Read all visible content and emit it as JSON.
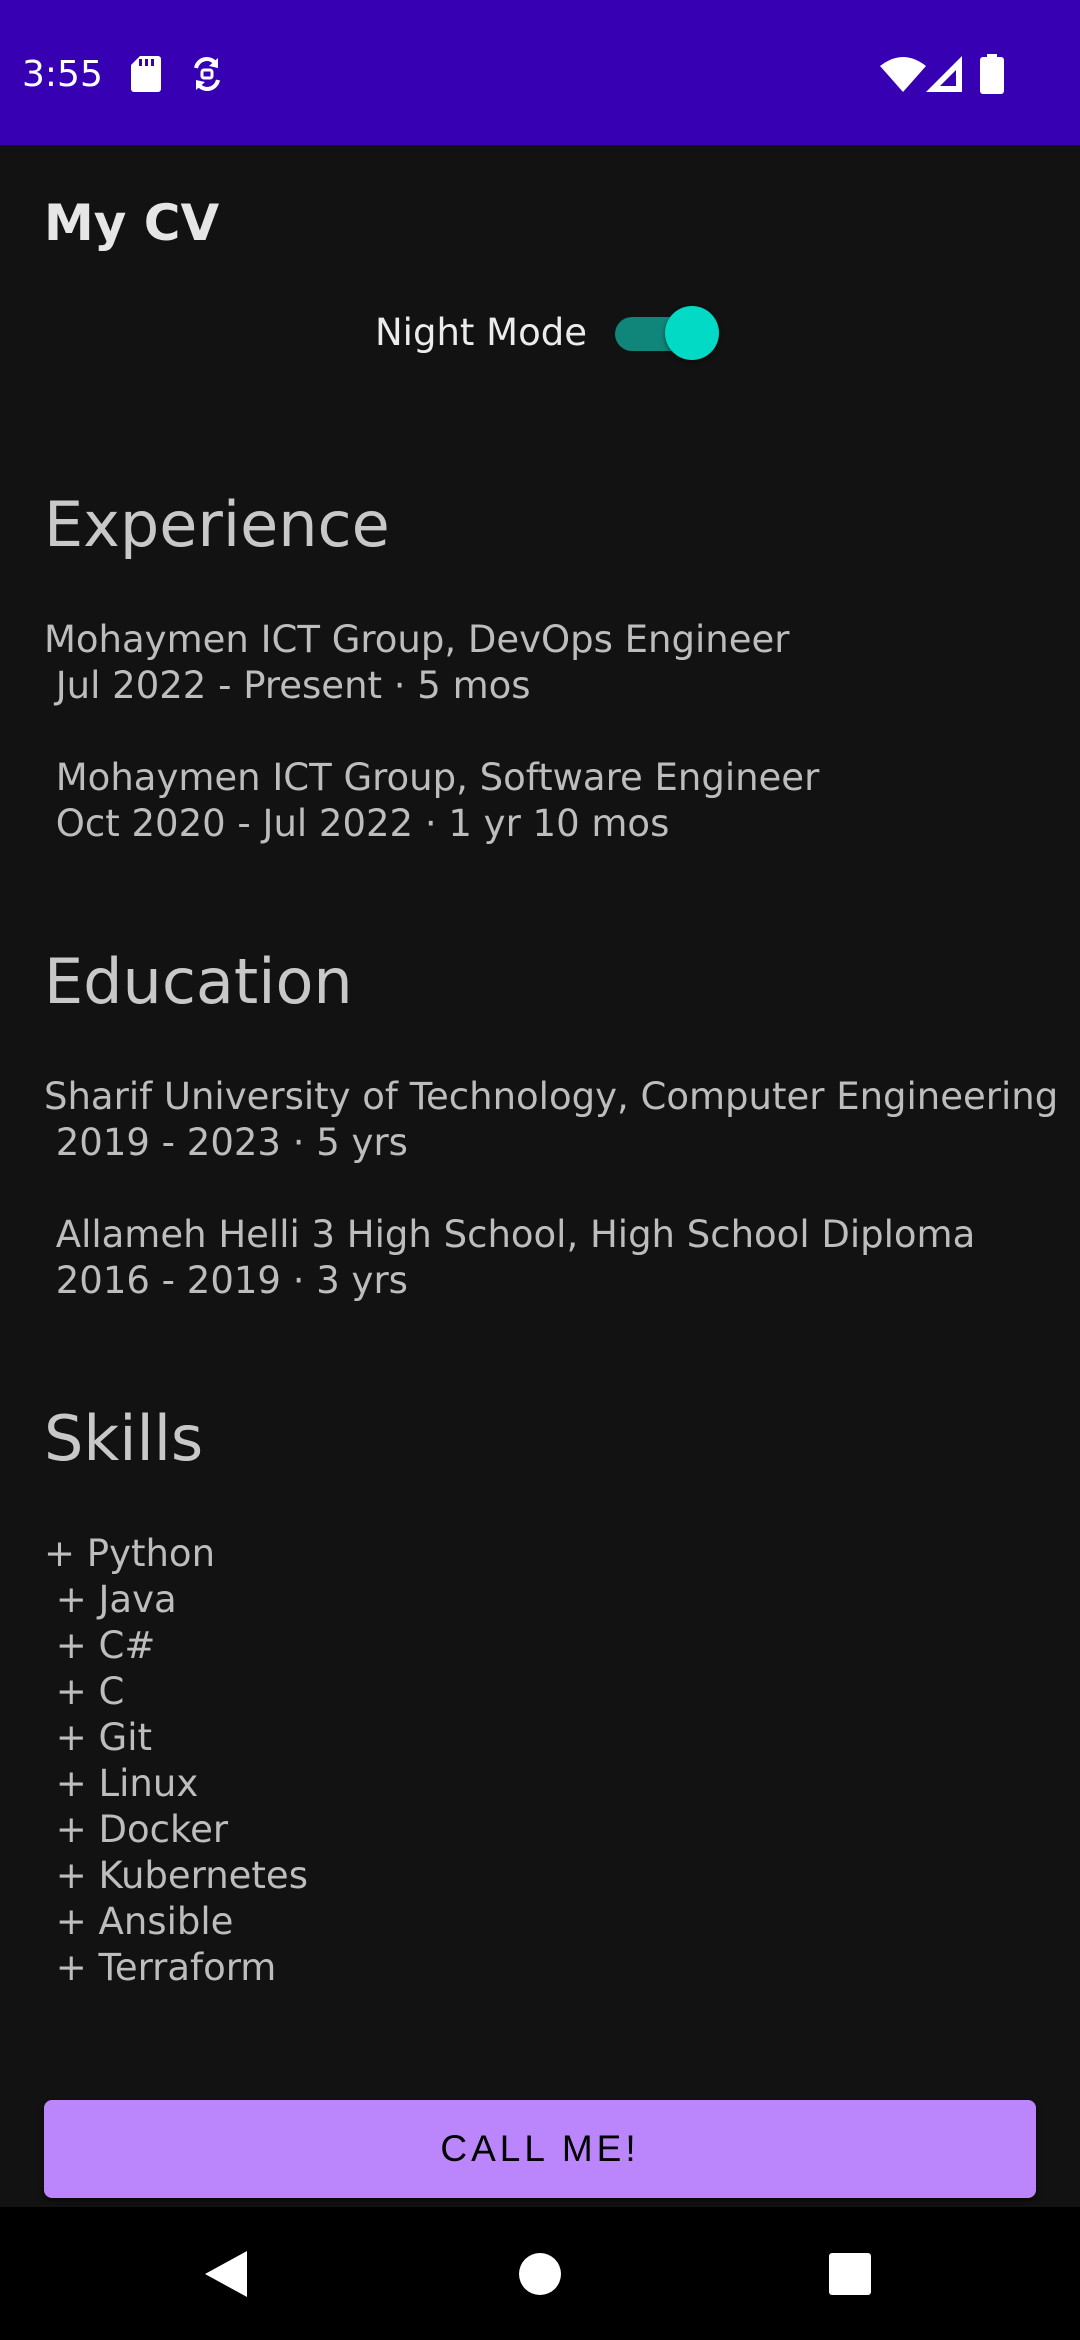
{
  "status_bar": {
    "time": "3:55",
    "icons_left": [
      "sd-card-icon",
      "sync-icon"
    ],
    "icons_right": [
      "wifi-icon",
      "signal-icon",
      "battery-icon"
    ],
    "background_color": "#3700b3"
  },
  "app": {
    "title": "My CV",
    "night_mode_label": "Night Mode",
    "night_mode_on": true,
    "accent_color": "#03dac5"
  },
  "experience": {
    "heading": "Experience",
    "body": "Mohaymen ICT Group, DevOps Engineer\n Jul 2022 - Present · 5 mos\n\n Mohaymen ICT Group, Software Engineer\n Oct 2020 - Jul 2022 · 1 yr 10 mos"
  },
  "education": {
    "heading": "Education",
    "body": "Sharif University of Technology, Computer Engineering\n 2019 - 2023 · 5 yrs\n\n Allameh Helli 3 High School, High School Diploma\n 2016 - 2019 · 3 yrs"
  },
  "skills": {
    "heading": "Skills",
    "body": "+ Python\n + Java\n + C#\n + C\n + Git\n + Linux\n + Docker\n + Kubernetes\n + Ansible\n + Terraform"
  },
  "call_button": {
    "label": "CALL ME!",
    "color": "#bb86fc"
  },
  "nav_bar": {
    "icons": [
      "back-icon",
      "home-icon",
      "recents-icon"
    ]
  }
}
